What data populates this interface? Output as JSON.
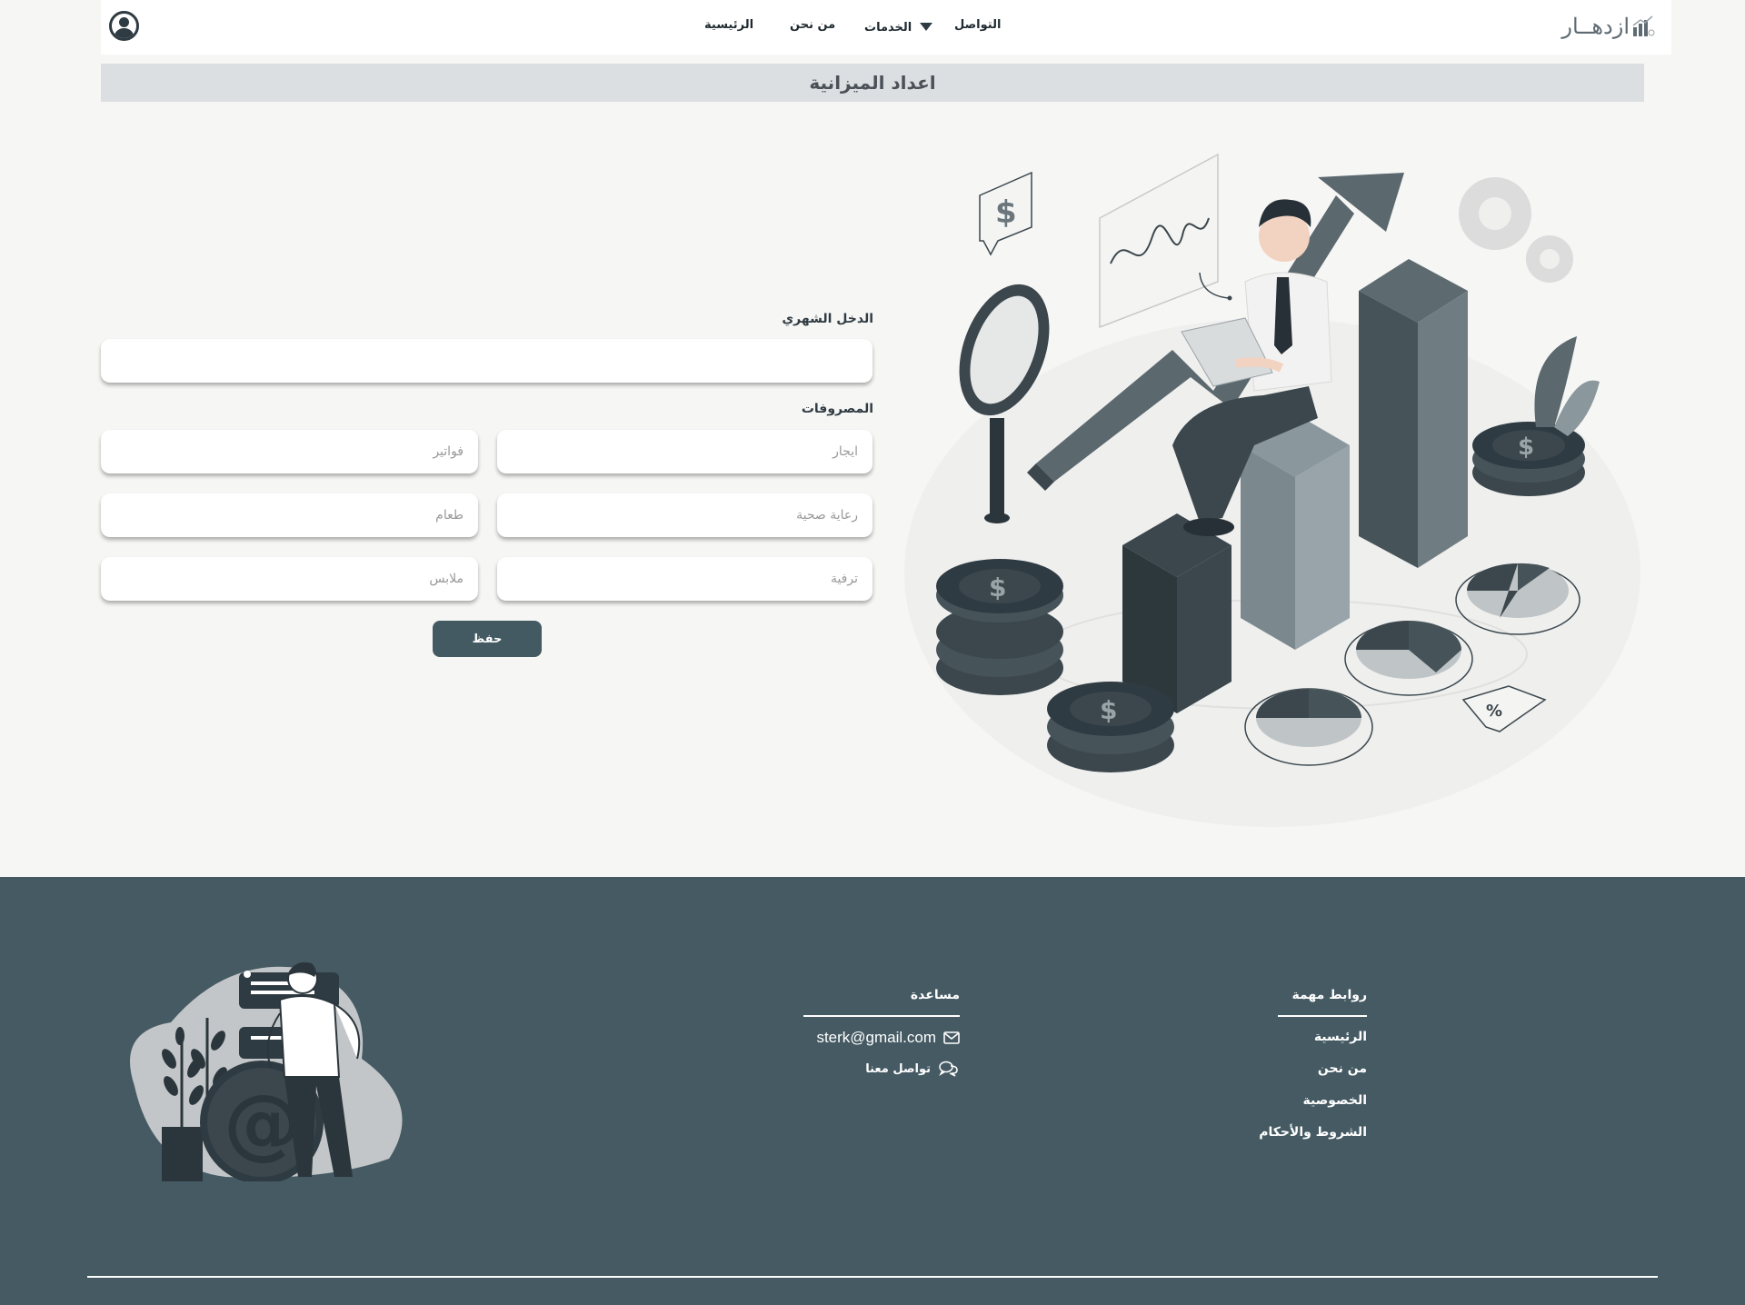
{
  "navbar": {
    "brand": "ازدهــار",
    "links": {
      "home": "الرئيسية",
      "about": "من نحن",
      "services": "الخدمات",
      "contact": "التواصل"
    },
    "profile_icon": "user-circle-icon",
    "services_icon": "caret-down-icon"
  },
  "page": {
    "title": "اعداد الميزانية"
  },
  "form": {
    "income_label": "الدخل الشهري",
    "income_value": "",
    "expenses_label": "المصروفات",
    "fields": {
      "rent": "ايجار",
      "bills": "فواتير",
      "healthcare": "رعاية صحية",
      "food": "طعام",
      "entertainment": "ترفية",
      "clothes": "ملابس"
    },
    "save_label": "حفظ"
  },
  "footer": {
    "links_heading": "روابط مهمة",
    "links": [
      "الرئيسية",
      "من نحن",
      "الخصوصية",
      "الشروط والأحكام"
    ],
    "help_heading": "مساعدة",
    "email": "sterk@gmail.com",
    "contact_us": "تواصل معنا",
    "email_icon": "envelope-icon",
    "contact_icon": "chat-bubbles-icon"
  },
  "colors": {
    "primary": "#455a63",
    "title_bar": "#dcdfe1",
    "background": "#f6f6f5",
    "dark": "#2f3b42"
  }
}
